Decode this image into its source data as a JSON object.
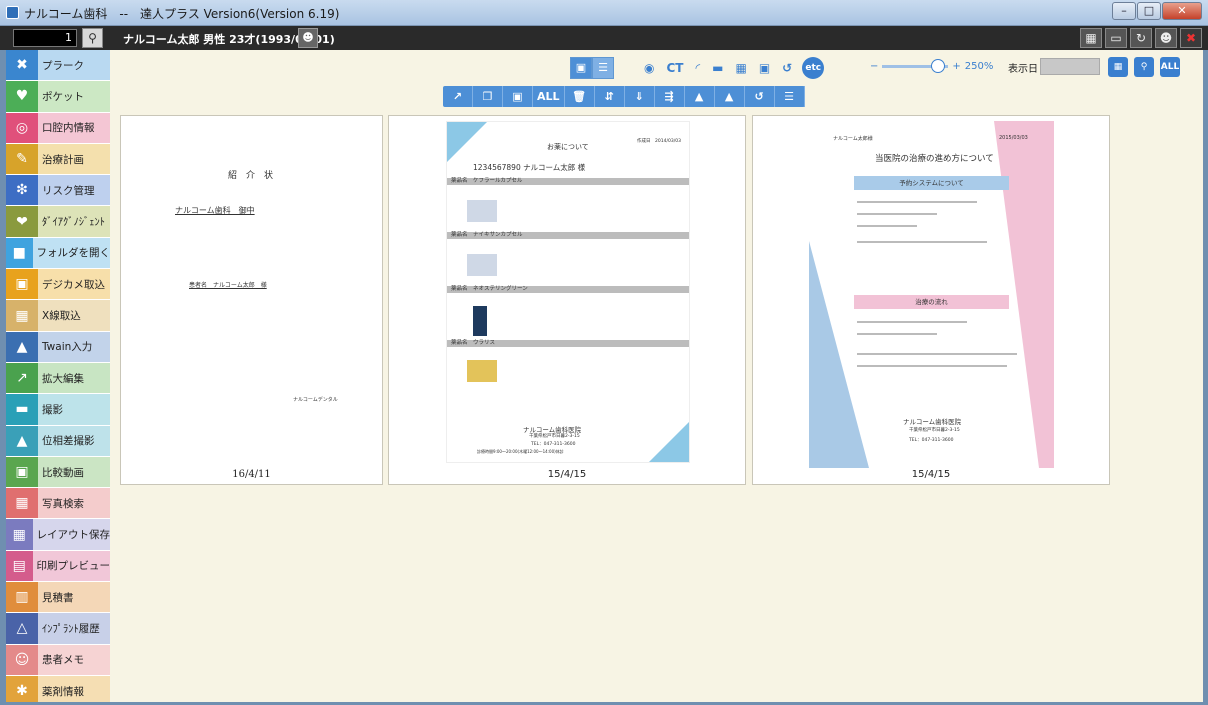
{
  "window": {
    "title": "ナルコーム歯科　--　達人プラス Version6(Version 6.19)",
    "minimize": "–",
    "maximize": "□",
    "close": "✕"
  },
  "patient": {
    "number": "1",
    "search_icon": "search-icon",
    "info": "ナルコーム太郎 男性 23才(1993/03/01)",
    "card_icon": "patient-card-icon",
    "tools": [
      "book-icon",
      "monitor-icon",
      "refresh-icon",
      "user-icon",
      "close-icon"
    ]
  },
  "sidebar": {
    "items": [
      {
        "label": "プラーク",
        "icon": "plaque-icon",
        "color": "#3a86cf",
        "bg": "#b9d9f1"
      },
      {
        "label": "ポケット",
        "icon": "tooth-icon",
        "color": "#4cae57",
        "bg": "#cce8c4"
      },
      {
        "label": "口腔内情報",
        "icon": "mouth-icon",
        "color": "#e0507b",
        "bg": "#f4c6d4"
      },
      {
        "label": "治療計画",
        "icon": "plan-icon",
        "color": "#d7a32a",
        "bg": "#f4e0ad"
      },
      {
        "label": "リスク管理",
        "icon": "risk-icon",
        "color": "#3d6ec4",
        "bg": "#bed0ee"
      },
      {
        "label": "ﾀﾞｲｱｸﾞﾉｼﾞｪﾝﾄ",
        "icon": "diagnosis-icon",
        "color": "#8a9a3e",
        "bg": "#dde3b8"
      },
      {
        "label": "フォルダを開く",
        "icon": "folder-icon",
        "color": "#3fa3df",
        "bg": "#bfe1f3"
      },
      {
        "label": "デジカメ取込",
        "icon": "camera-icon",
        "color": "#e8a21d",
        "bg": "#f7dfaa"
      },
      {
        "label": "X線取込",
        "icon": "xray-icon",
        "color": "#d7b26a",
        "bg": "#efe0be"
      },
      {
        "label": "Twain入力",
        "icon": "twain-icon",
        "color": "#3b6fb1",
        "bg": "#c2d3ea"
      },
      {
        "label": "拡大編集",
        "icon": "zoom-edit-icon",
        "color": "#4aa24e",
        "bg": "#c8e5c3"
      },
      {
        "label": "撮影",
        "icon": "shoot-icon",
        "color": "#2aa0b7",
        "bg": "#bde3ea"
      },
      {
        "label": "位相差撮影",
        "icon": "phase-icon",
        "color": "#3aa0b8",
        "bg": "#bee2ea"
      },
      {
        "label": "比較動画",
        "icon": "compare-icon",
        "color": "#5aa64f",
        "bg": "#cbe5c4"
      },
      {
        "label": "写真検索",
        "icon": "photo-search-icon",
        "color": "#e06f6f",
        "bg": "#f4cccc"
      },
      {
        "label": "レイアウト保存",
        "icon": "layout-icon",
        "color": "#7b7bbf",
        "bg": "#d6d6ec"
      },
      {
        "label": "印刷プレビュー",
        "icon": "print-icon",
        "color": "#d45c8c",
        "bg": "#f1c7d8"
      },
      {
        "label": "見積書",
        "icon": "estimate-icon",
        "color": "#e08d3c",
        "bg": "#f4d7b7"
      },
      {
        "label": "ｲﾝﾌﾟﾗﾝﾄ履歴",
        "icon": "implant-icon",
        "color": "#4a63a8",
        "bg": "#c8d0e8"
      },
      {
        "label": "患者メモ",
        "icon": "memo-icon",
        "color": "#e48a8a",
        "bg": "#f6d3d3"
      },
      {
        "label": "薬剤情報",
        "icon": "medicine-icon",
        "color": "#e2a33b",
        "bg": "#f5deb3"
      }
    ]
  },
  "toolbar": {
    "ct_label": "CT",
    "etc_label": "etc",
    "zoom_minus": "−",
    "zoom_plus": "+",
    "zoom_value": "250%",
    "zoom_level": 0.85,
    "display_date_label": "表示日",
    "action_all": "ALL",
    "right_all": "ALL"
  },
  "documents": [
    {
      "date": "16/4/11",
      "title": "紹　介　状",
      "recipient": "ナルコーム歯科　御中",
      "patient": "患者名　ナルコーム太郎　様",
      "clinic": "ナルコームデンタル"
    },
    {
      "date": "15/4/15",
      "title": "お薬について",
      "patient": "1234567890 ナルコーム太郎 様",
      "header_date": "作成日　2014/03/03",
      "drugs": [
        "薬品名　ケフラールカプセル",
        "薬品名　ナイキサンカプセル",
        "薬品名　ネオステリングリーン",
        "薬品名　ウラリス"
      ],
      "clinic": "ナルコーム歯科医院",
      "address": "千葉県松戸市日暮2-3-15",
      "tel": "TEL：047-311-3600",
      "hours": "診療時間9:00～20:00(木曜12:00～14:00)休診"
    },
    {
      "date": "15/4/15",
      "patient": "ナルコーム太郎様",
      "header_date": "2015/03/03",
      "title": "当医院の治療の進め方について",
      "section1": "予約システムについて",
      "section2": "治療の流れ",
      "clinic": "ナルコーム歯科医院",
      "address": "千葉県松戸市日暮2-3-15",
      "tel": "TEL：047-311-3600"
    }
  ]
}
